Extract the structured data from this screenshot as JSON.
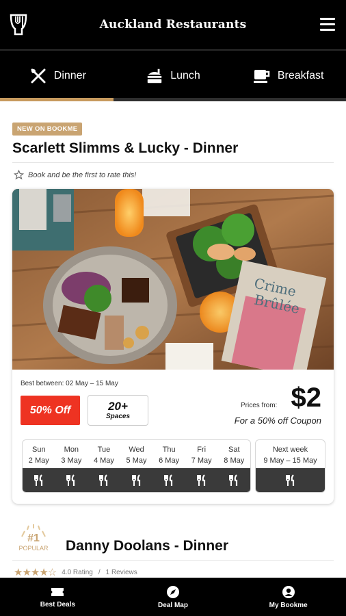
{
  "header": {
    "title": "Auckland Restaurants"
  },
  "tabs": [
    {
      "label": "Dinner",
      "icon": "cutlery-icon"
    },
    {
      "label": "Lunch",
      "icon": "burger-icon"
    },
    {
      "label": "Breakfast",
      "icon": "coffee-cup-icon"
    }
  ],
  "colors": {
    "accent": "#c79a5e",
    "discount": "#ee3322",
    "dark_bar": "#3a3a3a"
  },
  "restaurant1": {
    "badge": "NEW ON BOOKME",
    "name": "Scarlett Slimms & Lucky - Dinner",
    "rate_prompt": "Book and be the first to rate this!",
    "best_between": "Best between: 02 May – 15 May",
    "discount": "50% Off",
    "spaces_count": "20+",
    "spaces_label": "Spaces",
    "prices_from_label": "Prices from:",
    "price": "$2",
    "coupon": "For a 50% off Coupon",
    "days": [
      {
        "day": "Sun",
        "date": "2 May"
      },
      {
        "day": "Mon",
        "date": "3 May"
      },
      {
        "day": "Tue",
        "date": "4 May"
      },
      {
        "day": "Wed",
        "date": "5 May"
      },
      {
        "day": "Thu",
        "date": "6 May"
      },
      {
        "day": "Fri",
        "date": "7 May"
      },
      {
        "day": "Sat",
        "date": "8 May"
      }
    ],
    "next_week": {
      "label": "Next week",
      "range": "9 May – 15 May"
    }
  },
  "restaurant2": {
    "rank": "#1",
    "popular_label": "POPULAR",
    "name": "Danny Doolans - Dinner",
    "stars": 4,
    "rating_text": "4.0 Rating",
    "separator": "/",
    "reviews_text": "1 Reviews"
  },
  "bottom_nav": [
    {
      "label": "Best Deals",
      "icon": "ticket-icon"
    },
    {
      "label": "Deal Map",
      "icon": "compass-icon"
    },
    {
      "label": "My Bookme",
      "icon": "user-icon"
    }
  ]
}
